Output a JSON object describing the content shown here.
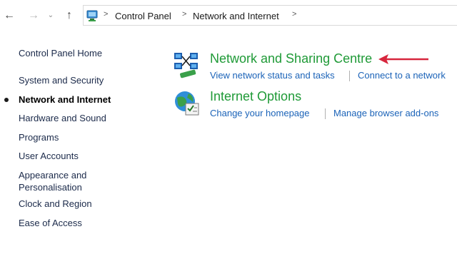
{
  "navigation": {
    "back_icon": "arrow-left-icon",
    "forward_icon": "arrow-right-icon",
    "recent_icon": "chevron-down-icon",
    "up_icon": "arrow-up-icon",
    "breadcrumb": [
      "Control Panel",
      "Network and Internet"
    ]
  },
  "sidebar": {
    "items": [
      "Control Panel Home",
      "System and Security",
      "Network and Internet",
      "Hardware and Sound",
      "Programs",
      "User Accounts",
      "Appearance and Personalisation",
      "Clock and Region",
      "Ease of Access"
    ],
    "active": "Network and Internet"
  },
  "categories": [
    {
      "title": "Network and Sharing Centre",
      "icon": "network-sharing-icon",
      "links": [
        "View network status and tasks",
        "Connect to a network"
      ]
    },
    {
      "title": "Internet Options",
      "icon": "internet-options-icon",
      "links": [
        "Change your homepage",
        "Manage browser add-ons"
      ]
    }
  ],
  "annotation": {
    "arrow_color": "#d7263d"
  },
  "colors": {
    "category_title": "#1f9a37",
    "link": "#1b63b8"
  }
}
